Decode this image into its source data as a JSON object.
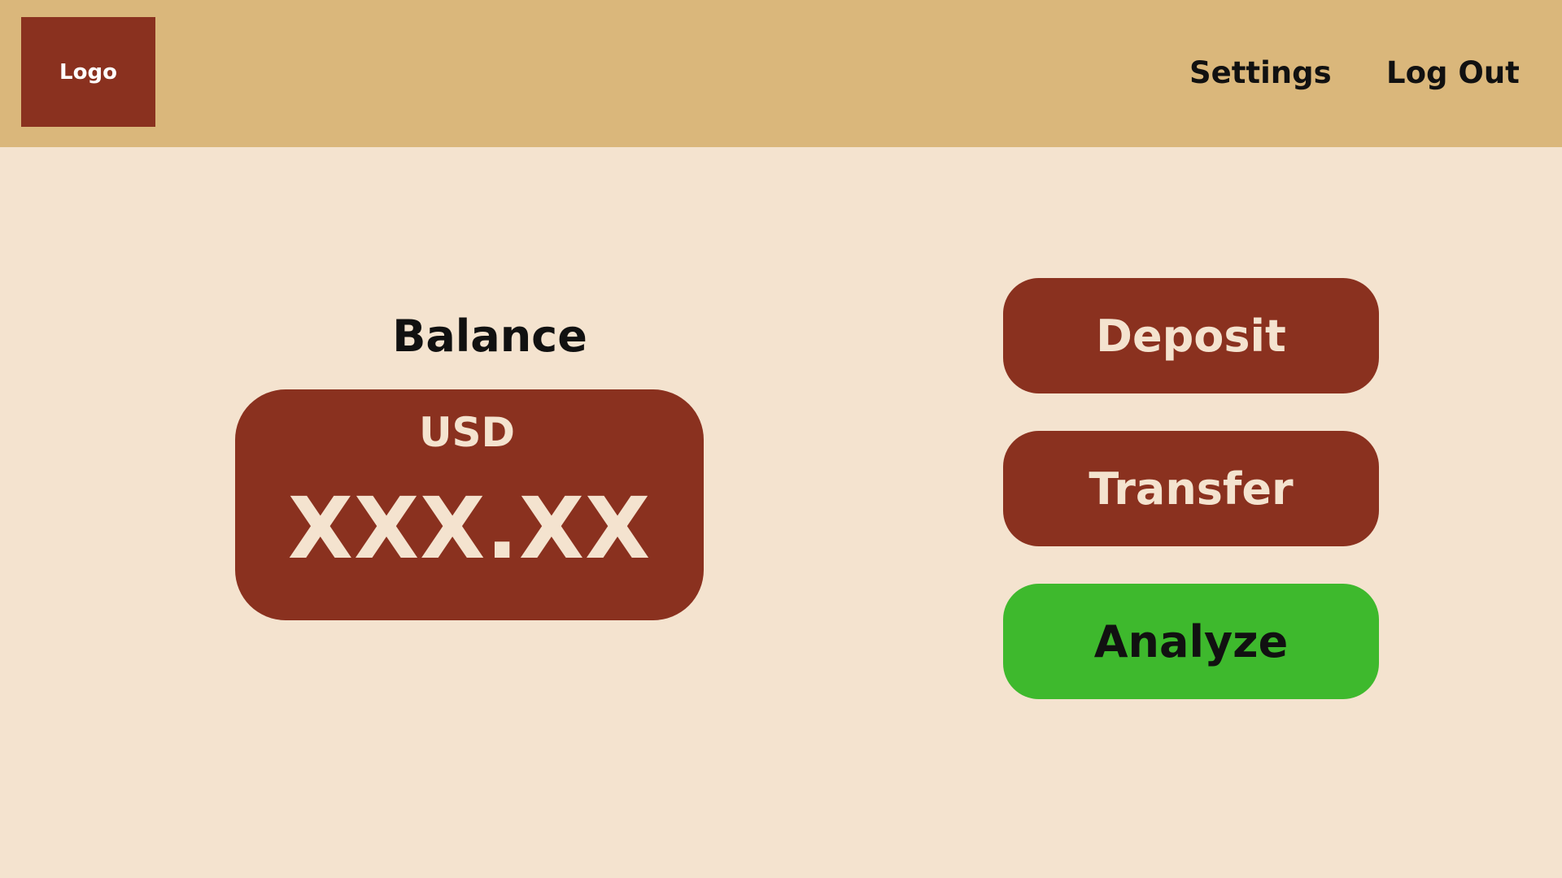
{
  "header": {
    "logo_label": "Logo",
    "nav": {
      "settings_label": "Settings",
      "logout_label": "Log Out"
    }
  },
  "balance": {
    "title": "Balance",
    "currency": "USD",
    "amount": "XXX.XX"
  },
  "actions": {
    "deposit_label": "Deposit",
    "transfer_label": "Transfer",
    "analyze_label": "Analyze"
  },
  "colors": {
    "background": "#f4e3cf",
    "header": "#dab77b",
    "primary": "#8a311f",
    "accent_green": "#3eb92d",
    "text_dark": "#111111"
  }
}
